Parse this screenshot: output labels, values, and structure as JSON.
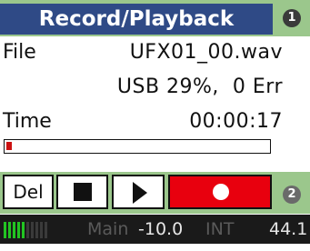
{
  "header": {
    "title": "Record/Playback",
    "badge": "1"
  },
  "info": {
    "file_label": "File",
    "file_name": "UFX01_00.wav",
    "storage": "USB 29%,  0 Err",
    "time_label": "Time",
    "time_value": "00:00:17",
    "progress": 0.02
  },
  "transport": {
    "del_label": "Del",
    "badge": "2",
    "rec_color": "#e8000e"
  },
  "status": {
    "meter_on": 5,
    "meter_total": 10,
    "channel": "Main",
    "level": "-10.0",
    "source": "INT",
    "rate": "44.1"
  },
  "colors": {
    "title_bg": "#2f4a86",
    "bar_green": "#9bc78c",
    "status_bg": "#1a1a1a"
  }
}
